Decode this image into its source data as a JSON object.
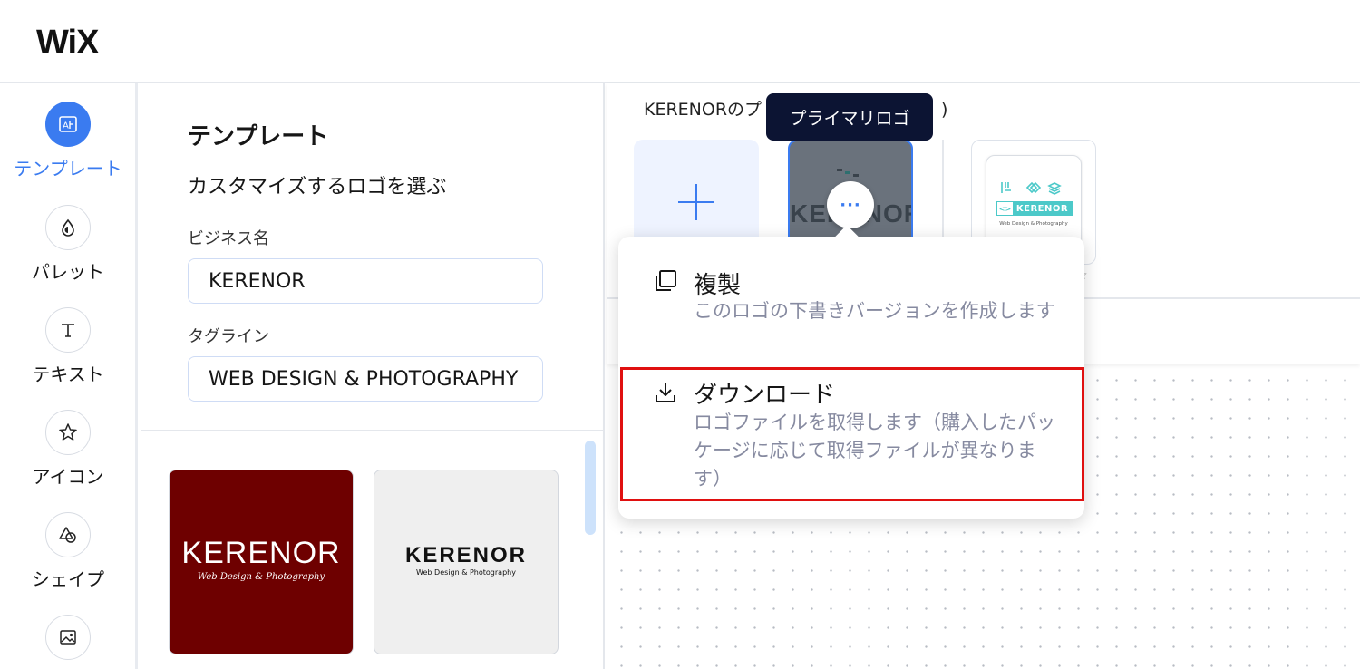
{
  "brand": {
    "logo": "WiX"
  },
  "rail": {
    "items": [
      {
        "label": "テンプレート",
        "icon": "template-icon",
        "active": true
      },
      {
        "label": "パレット",
        "icon": "palette-icon"
      },
      {
        "label": "テキスト",
        "icon": "text-icon"
      },
      {
        "label": "アイコン",
        "icon": "star-icon"
      },
      {
        "label": "シェイプ",
        "icon": "shapes-icon"
      },
      {
        "label": "",
        "icon": "image-icon"
      }
    ],
    "accent": "#3a7bf0"
  },
  "panel": {
    "title": "テンプレート",
    "subtitle": "カスタマイズするロゴを選ぶ",
    "business_label": "ビジネス名",
    "business_value": "KERENOR",
    "tagline_label": "タグライン",
    "tagline_value": "WEB DESIGN & PHOTOGRAPHY",
    "templates": [
      {
        "name": "KERENOR",
        "tagline": "Web Design & Photography",
        "bg": "#6e0000"
      },
      {
        "name": "KERENOR",
        "tagline": "Web Design & Photography",
        "bg": "#efefef"
      }
    ]
  },
  "main": {
    "strip_title": "KERENORのプ",
    "strip_title_tail": ")",
    "primary_logo_text": "KERENOR",
    "alt_logo": {
      "name": "KERENOR",
      "tagline": "Web Design & Photography",
      "accent": "#4cc9c9"
    }
  },
  "tooltip": {
    "text": "プライマリロゴ"
  },
  "more_button": {
    "label": "···"
  },
  "menu": {
    "items": [
      {
        "title": "複製",
        "desc": "このロゴの下書きバージョンを作成します",
        "icon": "duplicate-icon"
      },
      {
        "title": "ダウンロード",
        "desc": "ロゴファイルを取得します（購入したパッケージに応じて取得ファイルが異なります）",
        "icon": "download-icon",
        "highlighted": true
      }
    ],
    "highlight_color": "#e01010"
  }
}
